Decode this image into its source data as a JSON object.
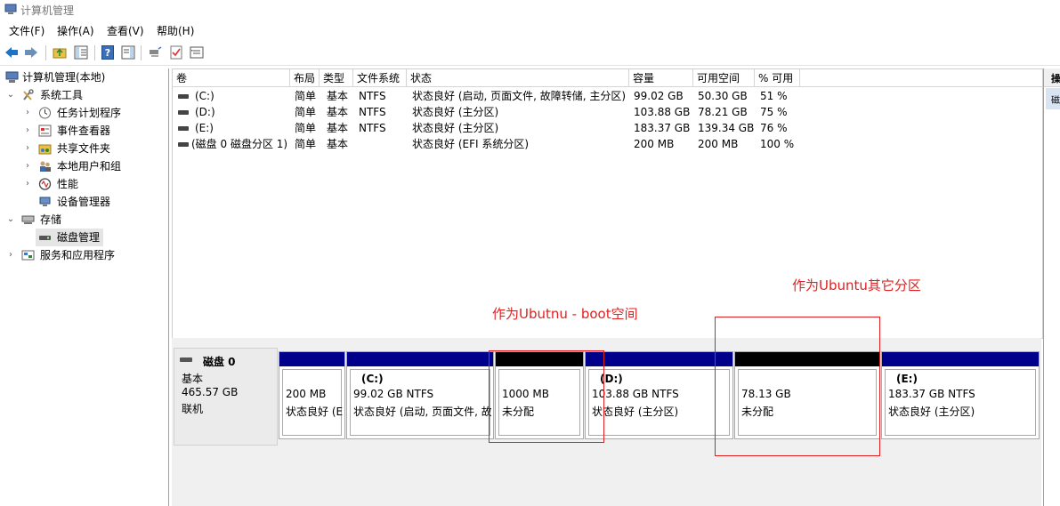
{
  "window": {
    "title": "计算机管理"
  },
  "menu": [
    "文件(F)",
    "操作(A)",
    "查看(V)",
    "帮助(H)"
  ],
  "tree": {
    "root": "计算机管理(本地)",
    "system_tools": "系统工具",
    "task_scheduler": "任务计划程序",
    "event_viewer": "事件查看器",
    "shared_folders": "共享文件夹",
    "local_users": "本地用户和组",
    "performance": "性能",
    "device_manager": "设备管理器",
    "storage": "存储",
    "disk_management": "磁盘管理",
    "services_apps": "服务和应用程序"
  },
  "volume_list": {
    "columns": [
      "卷",
      "布局",
      "类型",
      "文件系统",
      "状态",
      "容量",
      "可用空间",
      "% 可用"
    ],
    "rows": [
      [
        "(C:)",
        "简单",
        "基本",
        "NTFS",
        "状态良好 (启动, 页面文件, 故障转储, 主分区)",
        "99.02 GB",
        "50.30 GB",
        "51 %"
      ],
      [
        "(D:)",
        "简单",
        "基本",
        "NTFS",
        "状态良好 (主分区)",
        "103.88 GB",
        "78.21 GB",
        "75 %"
      ],
      [
        "(E:)",
        "简单",
        "基本",
        "NTFS",
        "状态良好 (主分区)",
        "183.37 GB",
        "139.34 GB",
        "76 %"
      ],
      [
        "(磁盘 0 磁盘分区 1)",
        "简单",
        "基本",
        "",
        "状态良好 (EFI 系统分区)",
        "200 MB",
        "200 MB",
        "100 %"
      ]
    ]
  },
  "disk": {
    "name": "磁盘 0",
    "type": "基本",
    "size": "465.57 GB",
    "status": "联机",
    "partitions": [
      {
        "label": "",
        "size": "200 MB",
        "status": "状态良好 (EFI 系统分区)"
      },
      {
        "label": "(C:)",
        "size": "99.02 GB NTFS",
        "status": "状态良好 (启动, 页面文件, 故障转储, 主分区)"
      },
      {
        "label": "",
        "size": "1000 MB",
        "status": "未分配"
      },
      {
        "label": "(D:)",
        "size": "103.88 GB NTFS",
        "status": "状态良好 (主分区)"
      },
      {
        "label": "",
        "size": "78.13 GB",
        "status": "未分配"
      },
      {
        "label": "(E:)",
        "size": "183.37 GB NTFS",
        "status": "状态良好 (主分区)"
      }
    ]
  },
  "annotations": {
    "boot": "作为Ubutnu - boot空间",
    "other": "作为Ubuntu其它分区"
  },
  "actions": {
    "title": "操",
    "sub": "磁"
  },
  "colors": {
    "primary_bar": "#00008b",
    "unallocated_bar": "#000000",
    "annotation": "#e02020"
  }
}
